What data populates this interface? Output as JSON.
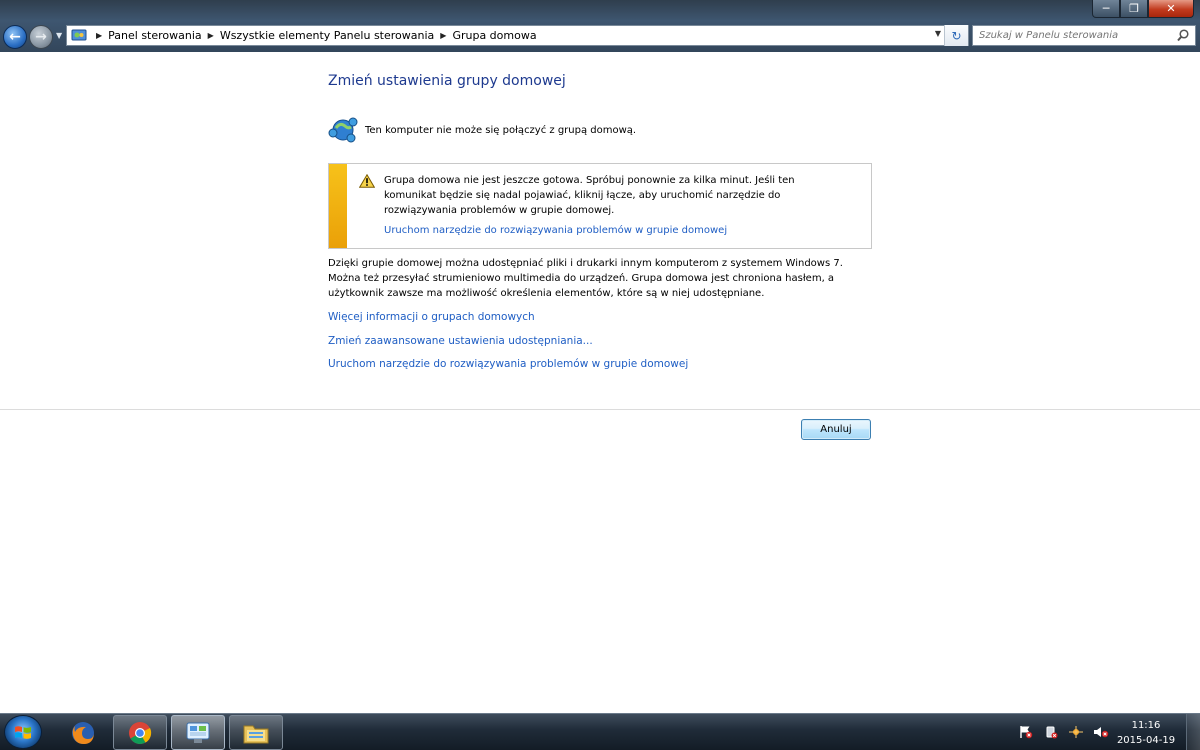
{
  "window": {
    "minimize_label": "─",
    "maximize_label": "❐",
    "close_label": "✕"
  },
  "addressbar": {
    "breadcrumbs": [
      "Panel sterowania",
      "Wszystkie elementy Panelu sterowania",
      "Grupa domowa"
    ],
    "search_placeholder": "Szukaj w Panelu sterowania"
  },
  "main": {
    "title": "Zmień ustawienia grupy domowej",
    "status": "Ten komputer nie może się połączyć z grupą domową.",
    "warning": {
      "text": "Grupa domowa nie jest jeszcze gotowa. Spróbuj ponownie za kilka minut. Jeśli ten komunikat będzie się nadal pojawiać, kliknij łącze, aby uruchomić narzędzie do rozwiązywania problemów w grupie domowej.",
      "link": "Uruchom narzędzie do rozwiązywania problemów w grupie domowej"
    },
    "description": "Dzięki grupie domowej można udostępniać pliki i drukarki innym komputerom z systemem Windows 7. Można też przesyłać strumieniowo multimedia do urządzeń. Grupa domowa jest chroniona hasłem, a użytkownik zawsze ma możliwość określenia elementów, które są w niej udostępniane.",
    "links": [
      "Więcej informacji o grupach domowych",
      "Zmień zaawansowane ustawienia udostępniania...",
      "Uruchom narzędzie do rozwiązywania problemów w grupie domowej"
    ],
    "cancel_label": "Anuluj"
  },
  "taskbar": {
    "apps": [
      "firefox-icon",
      "chrome-icon",
      "control-panel-icon",
      "explorer-icon"
    ],
    "tray_icons": [
      "action-center-flag-icon",
      "safely-remove-icon",
      "network-icon",
      "volume-muted-icon"
    ],
    "time": "11:16",
    "date": "2015-04-19"
  },
  "colors": {
    "link": "#1f5ec4",
    "title": "#1e3a8f",
    "warning_stripe": "#f2b40f"
  }
}
